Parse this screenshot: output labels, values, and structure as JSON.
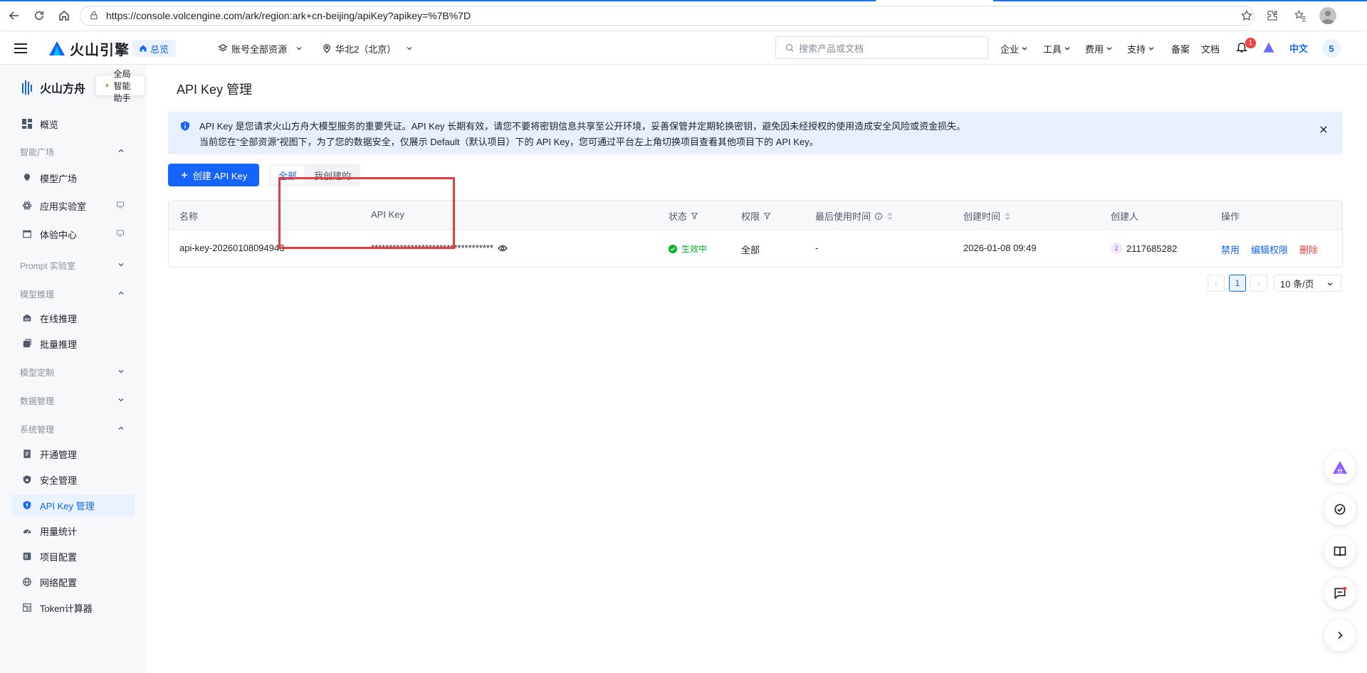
{
  "browser": {
    "url": "https://console.volcengine.com/ark/region:ark+cn-beijing/apiKey?apikey=%7B%7D"
  },
  "header": {
    "logo_text": "火山引擎",
    "overview": "总览",
    "account_resources": "账号全部资源",
    "region": "华北2（北京）",
    "search_placeholder": "搜索产品或文档",
    "nav": [
      "企业",
      "工具",
      "费用",
      "支持",
      "备案",
      "文档"
    ],
    "bell_count": "1",
    "lang": "中文",
    "user_initial": "5"
  },
  "sidebar": {
    "product_name": "火山方舟",
    "assistant_tip": "全局智能助手",
    "overview": "概览",
    "groups": {
      "g1": "智能广场",
      "g2": "Prompt 实验室",
      "g3": "模型推理",
      "g4": "模型定制",
      "g5": "数据管理",
      "g6": "系统管理"
    },
    "items": {
      "model_square": "模型广场",
      "app_lab": "应用实验室",
      "experience": "体验中心",
      "online_inference": "在线推理",
      "batch_inference": "批量推理",
      "activation": "开通管理",
      "security": "安全管理",
      "api_key": "API Key 管理",
      "usage": "用量统计",
      "project": "项目配置",
      "network": "网络配置",
      "token_calc": "Token计算器"
    }
  },
  "main": {
    "title": "API Key 管理",
    "alert_line1": "API Key 是您请求火山方舟大模型服务的重要凭证。API Key 长期有效，请您不要将密钥信息共享至公开环境，妥善保管并定期轮换密钥，避免因未经授权的使用造成安全风险或资金损失。",
    "alert_line2": "当前您在“全部资源”视图下，为了您的数据安全，仅展示 Default（默认项目）下的 API Key，您可通过平台左上角切换项目查看其他项目下的 API Key。",
    "create_button": "创建 API Key",
    "filter_all": "全部",
    "filter_mine": "我创建的",
    "columns": {
      "name": "名称",
      "api_key": "API Key",
      "status": "状态",
      "permission": "权限",
      "last_used": "最后使用时间",
      "created_time": "创建时间",
      "creator": "创建人",
      "actions": "操作"
    },
    "rows": [
      {
        "name": "api-key-20260108094943",
        "api_key": "**********************************",
        "status": "生效中",
        "permission": "全部",
        "last_used": "-",
        "created_time": "2026-01-08 09:49",
        "creator_badge": "2",
        "creator": "2117685282",
        "action_disable": "禁用",
        "action_edit": "编辑权限",
        "action_delete": "删除"
      }
    ],
    "pagination": {
      "prev": "‹",
      "current_page": "1",
      "next": "›",
      "page_size": "10 条/页"
    }
  },
  "colors": {
    "primary": "#1664ff",
    "success": "#00b42a",
    "danger": "#f53f3f",
    "highlight": "#e53e3e"
  }
}
